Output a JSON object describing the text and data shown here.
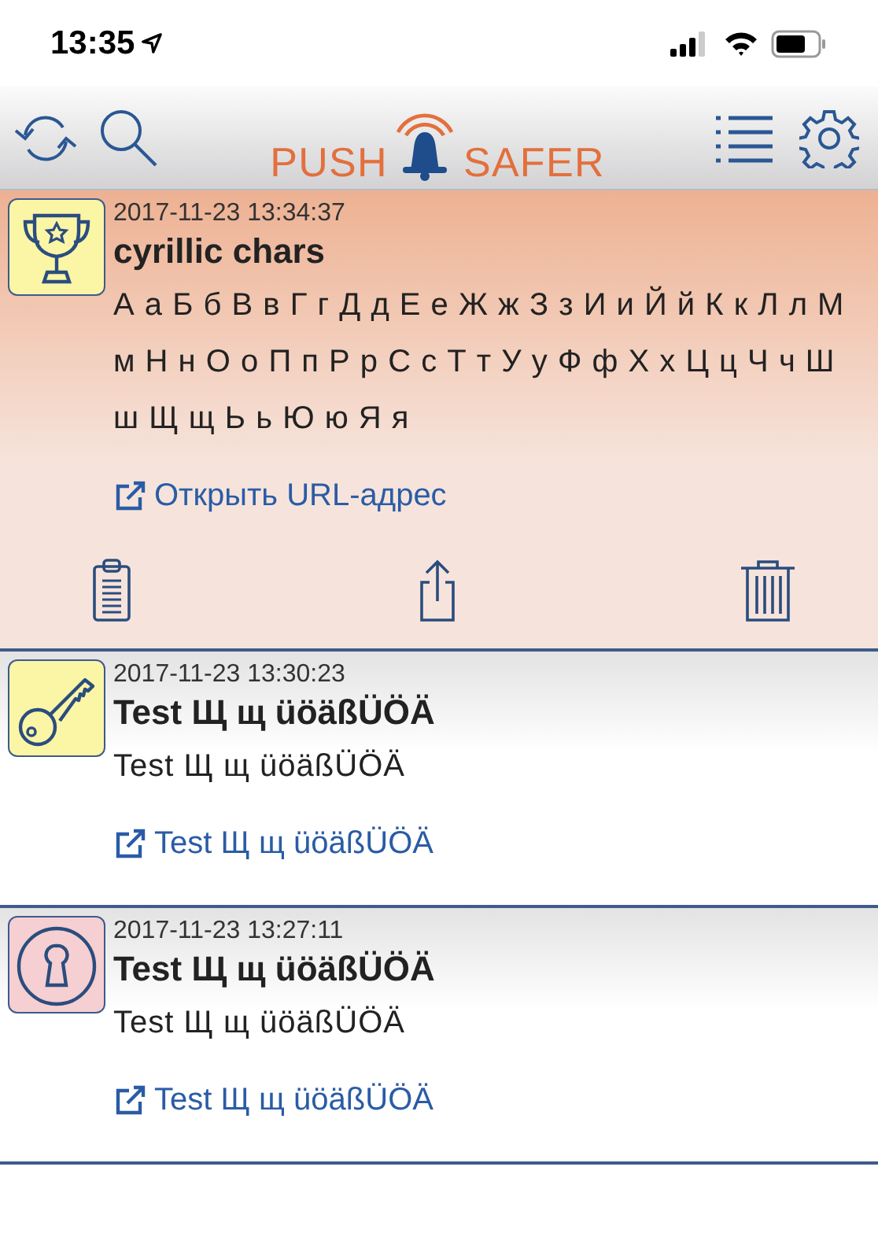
{
  "status_bar": {
    "time": "13:35"
  },
  "header": {
    "logo": {
      "left": "PUSH",
      "right": "SAFER"
    }
  },
  "messages": [
    {
      "kind": "trophy",
      "color": "#fbf5a6",
      "selected": true,
      "time": "2017-11-23 13:34:37",
      "title": "cyrillic chars",
      "body": "А а Б б В в Г г Д д Е е Ж ж З з И и Й й К к Л л М м Н н О о П п Р р С с Т т У у Ф ф Х х Ц ц Ч ч Ш ш Щ щ Ь ь Ю ю Я я",
      "link": "Открыть URL-адрес"
    },
    {
      "kind": "key",
      "color": "#fbf5a6",
      "selected": false,
      "time": "2017-11-23 13:30:23",
      "title": "Test Щ щ üöäßÜÖÄ",
      "body": "Test Щ щ üöäßÜÖÄ",
      "link": "Test Щ щ üöäßÜÖÄ"
    },
    {
      "kind": "keyhole",
      "color": "#f5cfd1",
      "selected": false,
      "time": "2017-11-23 13:27:11",
      "title": "Test Щ щ üöäßÜÖÄ",
      "body": "Test Щ щ üöäßÜÖÄ",
      "link": "Test Щ щ üöäßÜÖÄ"
    }
  ]
}
